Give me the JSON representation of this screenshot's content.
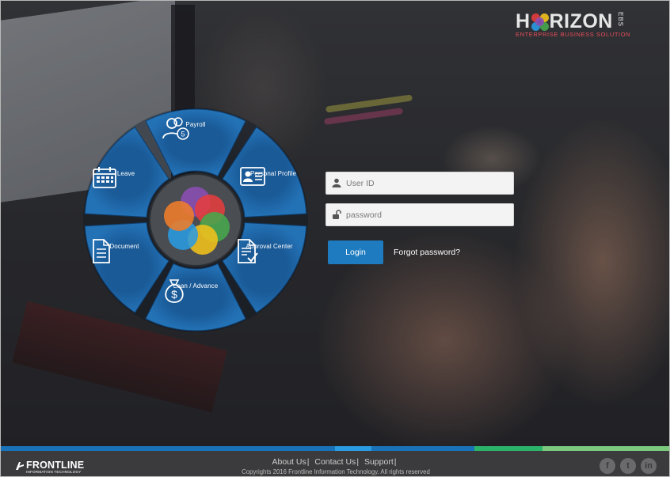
{
  "brand": {
    "name_left": "H",
    "name_right": "RIZON",
    "suffix": "EBS",
    "tagline": "ENTERPRISE BUSINESS SOLUTION"
  },
  "modules": [
    {
      "label": "Payroll",
      "icon": "payroll-people-icon"
    },
    {
      "label": "Personal Profile",
      "icon": "id-card-icon"
    },
    {
      "label": "Approval Center",
      "icon": "approval-document-icon"
    },
    {
      "label": "Loan / Advance",
      "icon": "money-bag-icon"
    },
    {
      "label": "Document",
      "icon": "document-icon"
    },
    {
      "label": "Leave",
      "icon": "calendar-icon"
    }
  ],
  "payroll_badge": "5",
  "login": {
    "user_placeholder": "User ID",
    "password_placeholder": "password",
    "login_label": "Login",
    "forgot_label": "Forgot password?"
  },
  "footer": {
    "company_name": "FRONTLINE",
    "company_sub": "INFORMATION TECHNOLOGY",
    "links": [
      "About Us",
      "Contact Us",
      "Support"
    ],
    "separator": "|",
    "copyright": "Copyrights 2016 Frontline Information Technology. All rights reserved",
    "social": [
      {
        "icon": "facebook-icon",
        "glyph": "f"
      },
      {
        "icon": "twitter-icon",
        "glyph": "t"
      },
      {
        "icon": "linkedin-icon",
        "glyph": "in"
      }
    ]
  },
  "colors": {
    "wheel_blue": "#1d5f9e",
    "button_blue": "#1e7bc0",
    "brand_red": "#e74c5a",
    "footer_bg": "#3b3b3d",
    "stripe": [
      "#1a73b8",
      "#2a9be0",
      "#1a73b8",
      "#2bb36a",
      "#7bc97d"
    ]
  }
}
